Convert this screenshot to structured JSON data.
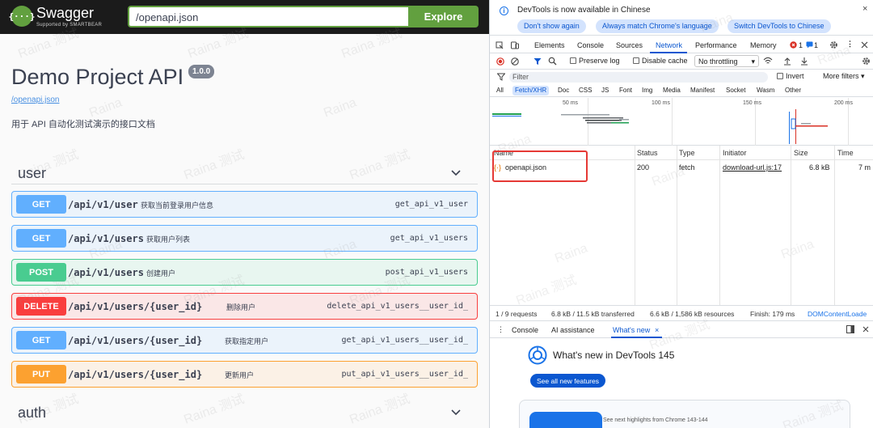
{
  "swagger": {
    "brand": "Swagger",
    "brand_sub": "Supported by SMARTBEAR",
    "url_value": "/openapi.json",
    "explore_label": "Explore",
    "title": "Demo Project API",
    "version": "1.0.0",
    "spec_link": "/openapi.json",
    "description": "用于 API 自动化测试演示的接口文档",
    "tags": [
      {
        "name": "user"
      },
      {
        "name": "auth"
      }
    ],
    "operations": [
      {
        "method": "GET",
        "path": "/api/v1/user",
        "summary": "获取当前登录用户信息",
        "operation_id": "get_api_v1_user"
      },
      {
        "method": "GET",
        "path": "/api/v1/users",
        "summary": "获取用户列表",
        "operation_id": "get_api_v1_users"
      },
      {
        "method": "POST",
        "path": "/api/v1/users",
        "summary": "创建用户",
        "operation_id": "post_api_v1_users"
      },
      {
        "method": "DELETE",
        "path": "/api/v1/users/{user_id}",
        "summary": "删除用户",
        "operation_id": "delete_api_v1_users__user_id_"
      },
      {
        "method": "GET",
        "path": "/api/v1/users/{user_id}",
        "summary": "获取指定用户",
        "operation_id": "get_api_v1_users__user_id_"
      },
      {
        "method": "PUT",
        "path": "/api/v1/users/{user_id}",
        "summary": "更新用户",
        "operation_id": "put_api_v1_users__user_id_"
      }
    ],
    "method_colors": {
      "GET": "#61affe",
      "POST": "#49cc90",
      "DELETE": "#f93e3e",
      "PUT": "#fca130"
    }
  },
  "watermark": [
    "Raina 测试",
    "Raina"
  ],
  "devtools": {
    "banner": {
      "text": "DevTools is now available in Chinese",
      "btn_dont_show": "Don't show again",
      "btn_match": "Always match Chrome's language",
      "btn_switch": "Switch DevTools to Chinese",
      "close": "×"
    },
    "tabs": [
      "Elements",
      "Console",
      "Sources",
      "Network",
      "Performance",
      "Memory"
    ],
    "active_tab": "Network",
    "errors": "1",
    "messages": "1",
    "toolbar": {
      "preserve_log": "Preserve log",
      "disable_cache": "Disable cache",
      "throttling": "No throttling"
    },
    "filter": {
      "placeholder": "Filter",
      "invert": "Invert",
      "more_filters": "More filters"
    },
    "type_filters": [
      "All",
      "Fetch/XHR",
      "Doc",
      "CSS",
      "JS",
      "Font",
      "Img",
      "Media",
      "Manifest",
      "Socket",
      "Wasm",
      "Other"
    ],
    "active_type_filter": "Fetch/XHR",
    "timeline_ticks": [
      "50 ms",
      "100 ms",
      "150 ms",
      "200 ms"
    ],
    "columns": [
      "Name",
      "Status",
      "Type",
      "Initiator",
      "Size",
      "Time"
    ],
    "requests": [
      {
        "name": "openapi.json",
        "status": "200",
        "type": "fetch",
        "initiator": "download-url.js:17",
        "size": "6.8 kB",
        "time": "7 m"
      }
    ],
    "status_bar": {
      "requests": "1 / 9 requests",
      "transferred": "6.8 kB / 11.5 kB transferred",
      "resources": "6.6 kB / 1,586 kB resources",
      "finish": "Finish: 179 ms",
      "dcl": "DOMContentLoade"
    },
    "drawer_tabs": [
      "Console",
      "AI assistance",
      "What's new"
    ],
    "whats_new": {
      "title": "What's new in DevTools 145",
      "button": "See all new features",
      "card_text": "See next highlights from Chrome 143-144"
    },
    "colors": {
      "accent": "#0b57d0",
      "chip_bg": "#d3e3fd",
      "error": "#d93025",
      "highlight": "#e53935"
    }
  }
}
